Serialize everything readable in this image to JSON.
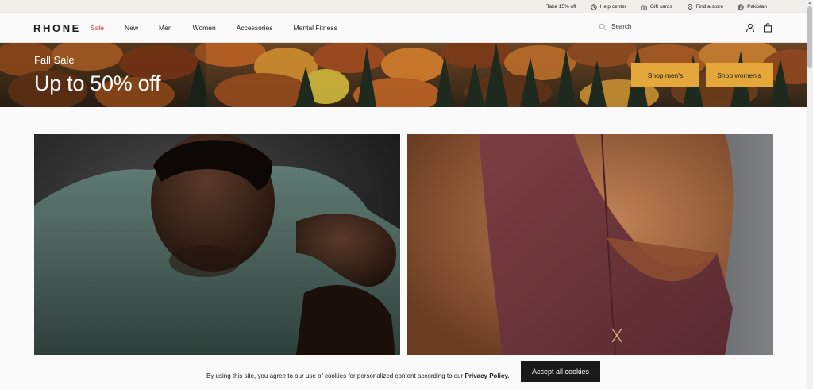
{
  "utility": {
    "promo": "Take 15% off",
    "help": "Help center",
    "gift": "Gift cards",
    "store": "Find a store",
    "country": "Pakistan"
  },
  "nav": {
    "logo": "RHONE",
    "links": [
      "Sale",
      "New",
      "Men",
      "Women",
      "Accessories",
      "Mental Fitness"
    ],
    "search_placeholder": "Search"
  },
  "hero": {
    "eyebrow": "Fall Sale",
    "headline": "Up to 50% off",
    "btn_men": "Shop men's",
    "btn_women": "Shop women's",
    "accent_color": "#e4a83a"
  },
  "cookie": {
    "text": "By using this site, you agree to our use of cookies for personalized content according to our ",
    "link": "Privacy Policy.",
    "accept": "Accept all cookies"
  },
  "icons": [
    "gift-icon",
    "help-icon",
    "gift-card-icon",
    "location-pin-icon",
    "globe-icon",
    "search-icon",
    "account-icon",
    "bag-icon"
  ]
}
